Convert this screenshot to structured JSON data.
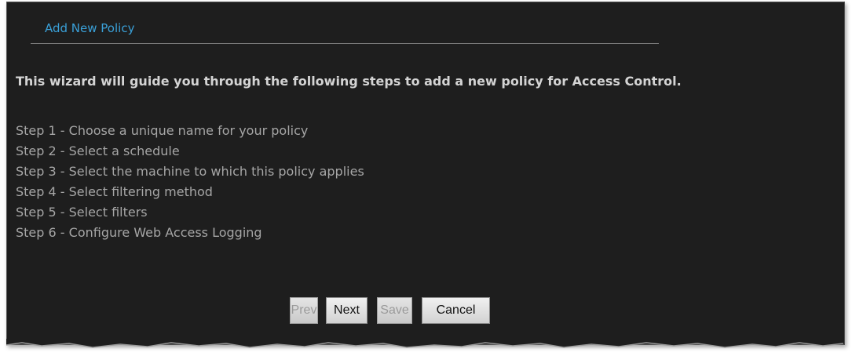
{
  "header": {
    "title": "Add New Policy"
  },
  "intro": "This wizard will guide you through the following steps to add a new policy for Access Control.",
  "steps": [
    "Step 1 - Choose a unique name for your policy",
    "Step 2 - Select a schedule",
    "Step 3 - Select the machine to which this policy applies",
    "Step 4 - Select filtering method",
    "Step 5 - Select filters",
    "Step 6 - Configure Web Access Logging"
  ],
  "buttons": {
    "prev": {
      "label": "Prev",
      "enabled": false
    },
    "next": {
      "label": "Next",
      "enabled": true
    },
    "save": {
      "label": "Save",
      "enabled": false
    },
    "cancel": {
      "label": "Cancel",
      "enabled": true
    }
  },
  "colors": {
    "background": "#1e1e1e",
    "title": "#3aa0d8",
    "intro": "#d4d4d4",
    "steps": "#a6a6a6"
  }
}
